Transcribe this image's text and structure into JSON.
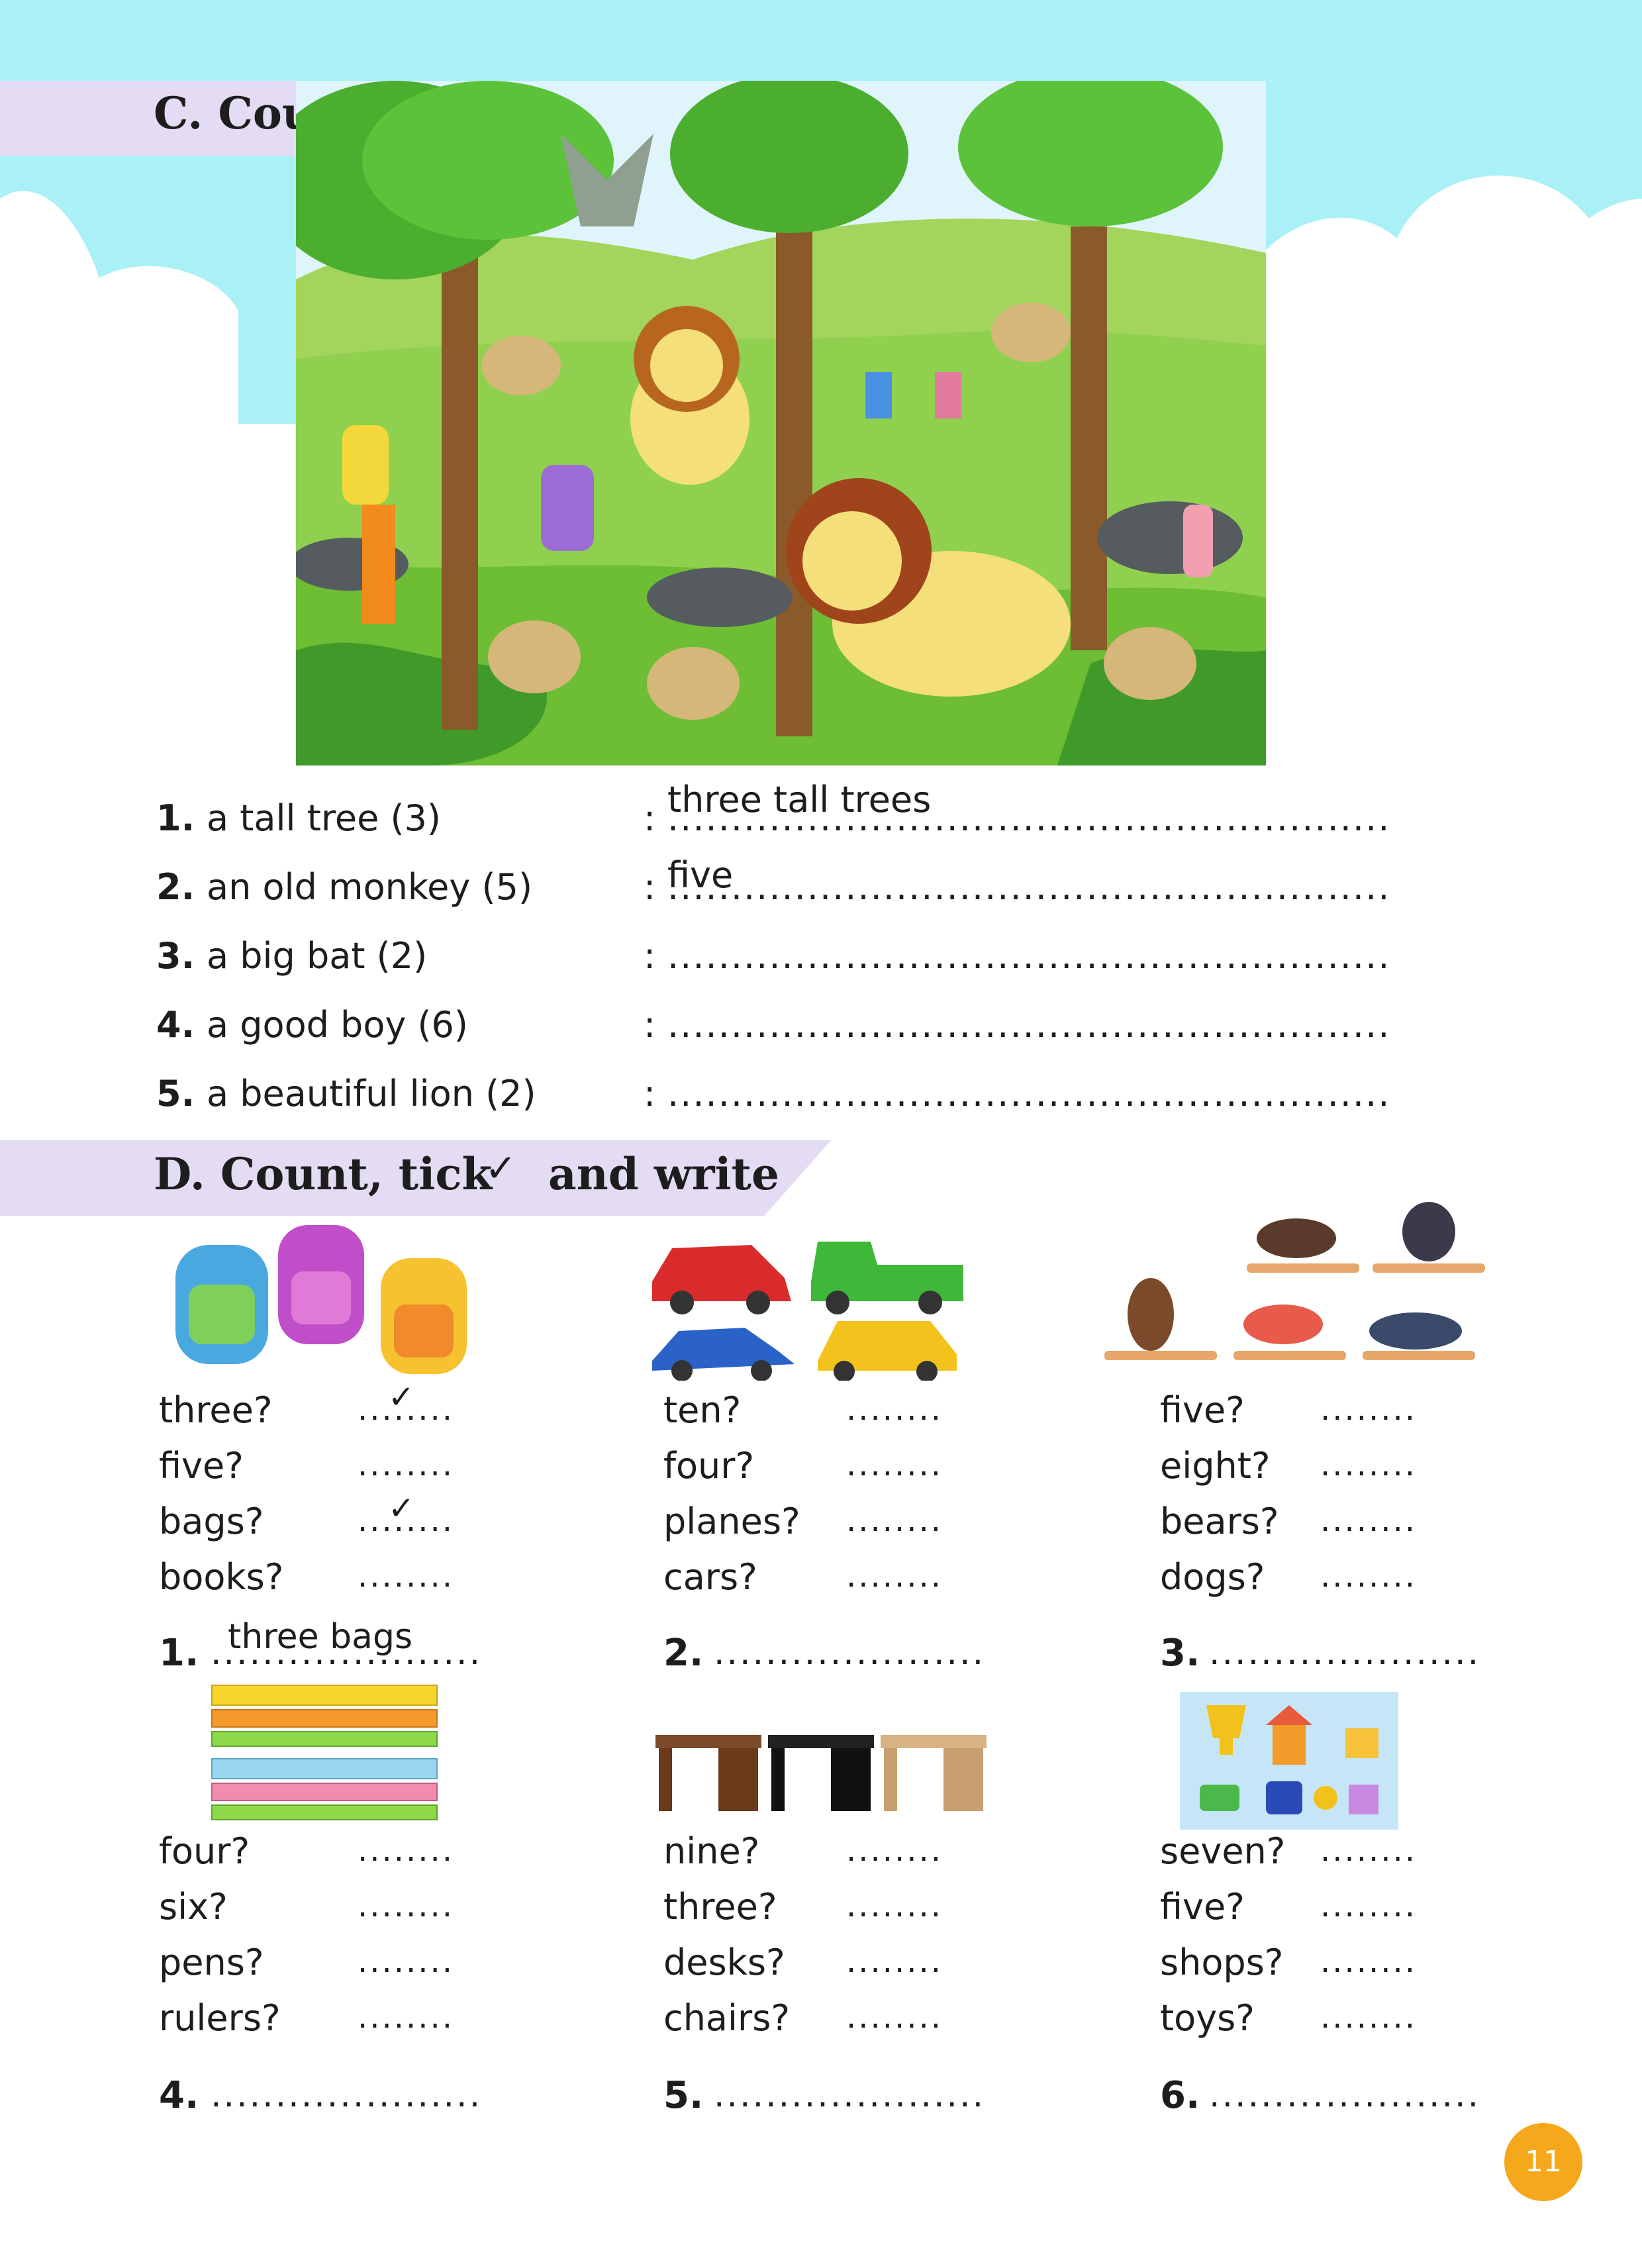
{
  "section_c": {
    "title": "C. Count and write",
    "items": [
      {
        "num": "1.",
        "text": "a tall tree (3)",
        "colon": ":",
        "answer": "three tall trees"
      },
      {
        "num": "2.",
        "text": "an old monkey (5)",
        "colon": ":",
        "answer": "five"
      },
      {
        "num": "3.",
        "text": "a big bat (2)",
        "colon": ":",
        "answer": ""
      },
      {
        "num": "4.",
        "text": "a good boy (6)",
        "colon": ":",
        "answer": ""
      },
      {
        "num": "5.",
        "text": "a beautiful lion (2)",
        "colon": ":",
        "answer": ""
      }
    ]
  },
  "section_d": {
    "title_part1": "D. Count, tick",
    "tick_symbol": "✓",
    "title_part2": "and write",
    "groups": [
      {
        "options": [
          "three?",
          "five?",
          "bags?",
          "books?"
        ],
        "ticked": [
          true,
          false,
          true,
          false
        ],
        "num": "1.",
        "answer": "three bags"
      },
      {
        "options": [
          "ten?",
          "four?",
          "planes?",
          "cars?"
        ],
        "ticked": [
          false,
          false,
          false,
          false
        ],
        "num": "2.",
        "answer": ""
      },
      {
        "options": [
          "five?",
          "eight?",
          "bears?",
          "dogs?"
        ],
        "ticked": [
          false,
          false,
          false,
          false
        ],
        "num": "3.",
        "answer": ""
      },
      {
        "options": [
          "four?",
          "six?",
          "pens?",
          "rulers?"
        ],
        "ticked": [
          false,
          false,
          false,
          false
        ],
        "num": "4.",
        "answer": ""
      },
      {
        "options": [
          "nine?",
          "three?",
          "desks?",
          "chairs?"
        ],
        "ticked": [
          false,
          false,
          false,
          false
        ],
        "num": "5.",
        "answer": ""
      },
      {
        "options": [
          "seven?",
          "five?",
          "shops?",
          "toys?"
        ],
        "ticked": [
          false,
          false,
          false,
          false
        ],
        "num": "6.",
        "answer": ""
      }
    ]
  },
  "page_number": "11",
  "colors": {
    "sky": "#a9f0f7",
    "banner": "#e4dcf4",
    "page_badge": "#f6a81c",
    "grass": "#8fd14f"
  }
}
